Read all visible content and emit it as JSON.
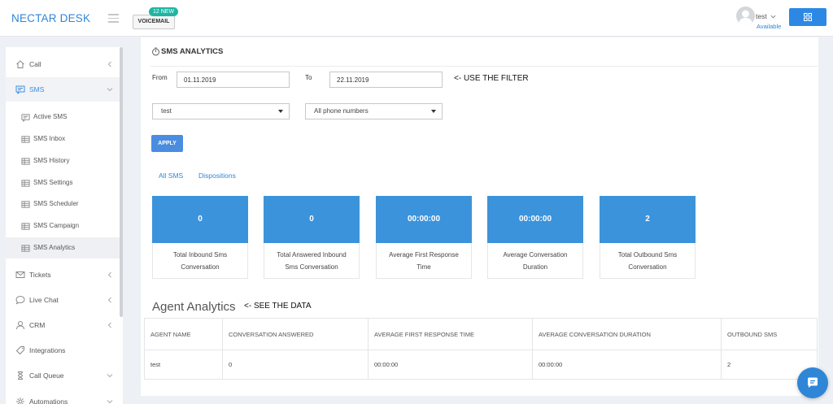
{
  "header": {
    "logo": "NECTAR DESK",
    "voicemail_badge": "12 NEW",
    "voicemail_label": "VOICEMAIL",
    "user_name": "test",
    "user_status": "Available",
    "menu_icon": "hamburger-icon",
    "apps_icon": "grid-icon"
  },
  "sidebar": {
    "items": [
      {
        "label": "Call",
        "icon": "home-icon",
        "expanded": false
      },
      {
        "label": "SMS",
        "icon": "message-icon",
        "expanded": true
      },
      {
        "label": "Tickets",
        "icon": "envelope-icon",
        "expanded": false
      },
      {
        "label": "Live Chat",
        "icon": "chat-bubble-icon",
        "expanded": false
      },
      {
        "label": "CRM",
        "icon": "user-icon",
        "expanded": false
      },
      {
        "label": "Integrations",
        "icon": "tag-icon",
        "expanded": false
      },
      {
        "label": "Call Queue",
        "icon": "hourglass-icon",
        "expanded": false
      },
      {
        "label": "Automations",
        "icon": "gear-icon",
        "expanded": false
      }
    ],
    "sms_subitems": [
      {
        "label": "Active SMS",
        "icon": "message-icon",
        "active": false
      },
      {
        "label": "SMS Inbox",
        "icon": "list-icon",
        "active": false
      },
      {
        "label": "SMS History",
        "icon": "list-icon",
        "active": false
      },
      {
        "label": "SMS Settings",
        "icon": "list-icon",
        "active": false
      },
      {
        "label": "SMS Scheduler",
        "icon": "list-icon",
        "active": false
      },
      {
        "label": "SMS Campaign",
        "icon": "list-icon",
        "active": false
      },
      {
        "label": "SMS Analytics",
        "icon": "list-icon",
        "active": true
      }
    ]
  },
  "page": {
    "title": "SMS ANALYTICS",
    "title_icon": "timer-icon"
  },
  "filter": {
    "from_label": "From",
    "from_value": "01.11.2019",
    "to_label": "To",
    "to_value": "22.11.2019",
    "agent_select": "test",
    "phone_select": "All phone numbers",
    "apply_label": "APPLY"
  },
  "annotations": {
    "filter_hint": "<- USE THE FILTER",
    "data_hint": "<- SEE THE DATA"
  },
  "tabs": [
    {
      "label": "All SMS"
    },
    {
      "label": "Dispositions"
    }
  ],
  "stats": [
    {
      "value": "0",
      "label": "Total Inbound Sms Conversation"
    },
    {
      "value": "0",
      "label": "Total Answered Inbound Sms Conversation"
    },
    {
      "value": "00:00:00",
      "label": "Average First Response Time"
    },
    {
      "value": "00:00:00",
      "label": "Average Conversation Duration"
    },
    {
      "value": "2",
      "label": "Total Outbound Sms Conversation"
    }
  ],
  "agent_analytics": {
    "title": "Agent Analytics",
    "columns": [
      "AGENT NAME",
      "CONVERSATION ANSWERED",
      "AVERAGE FIRST RESPONSE TIME",
      "AVERAGE CONVERSATION DURATION",
      "OUTBOUND SMS"
    ],
    "rows": [
      [
        "test",
        "0",
        "00:00:00",
        "00:00:00",
        "2"
      ]
    ]
  },
  "chat_widget": {
    "icon": "chat-icon"
  },
  "colors": {
    "brand": "#2f86d6",
    "badge": "#1fb5a3",
    "stat_card": "#3b93dc",
    "apply_button": "#4a8de0",
    "apps_button": "#2d88e4"
  }
}
